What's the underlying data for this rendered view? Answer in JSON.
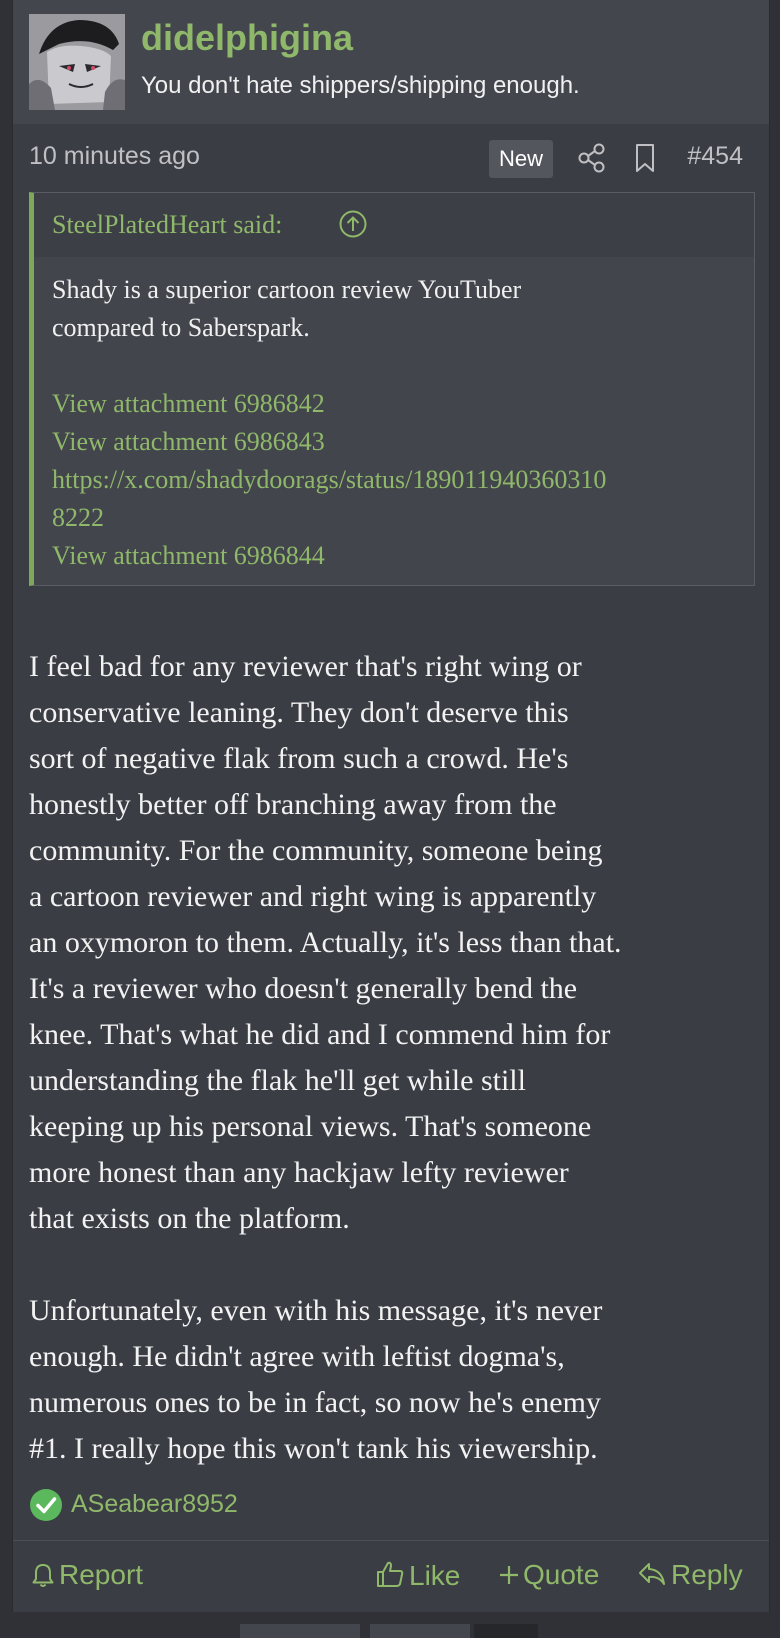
{
  "user": {
    "name": "didelphigina",
    "title": "You don't hate shippers/shipping enough."
  },
  "post": {
    "timestamp": "10 minutes ago",
    "badge": "New",
    "number": "#454"
  },
  "quote": {
    "author": "SteelPlatedHeart said:",
    "lines": [
      "Shady is a superior cartoon review YouTuber",
      "compared to Saberspark."
    ],
    "links": [
      "View attachment 6986842",
      "View attachment 6986843",
      "https://x.com/shadydoorags/status/189011940360310",
      "8222",
      "View attachment 6986844"
    ]
  },
  "message": {
    "paragraph1": [
      "I feel bad for any reviewer that's right wing or",
      "conservative leaning. They don't deserve this",
      "sort of negative flak from such a crowd. He's",
      "honestly better off branching away from the",
      "community. For the community, someone being",
      "a cartoon reviewer and right wing is apparently",
      "an oxymoron to them. Actually, it's less than that.",
      "It's a reviewer who doesn't generally bend the",
      "knee. That's what he did and I commend him for",
      "understanding the flak he'll get while still",
      "keeping up his personal views. That's someone",
      "more honest than any hackjaw lefty reviewer",
      "that exists on the platform."
    ],
    "paragraph2": [
      "Unfortunately, even with his message, it's never",
      "enough. He didn't agree with leftist dogma's,",
      "numerous ones to be in fact, so now he's enemy",
      "#1. I really hope this won't tank his viewership."
    ]
  },
  "reactions": {
    "user": "ASeabear8952"
  },
  "actions": {
    "report": "Report",
    "like": "Like",
    "quote": "Quote",
    "reply": "Reply"
  },
  "colors": {
    "accent": "#8fb86a",
    "background": "#2f3136",
    "panel": "#3b3d44"
  }
}
